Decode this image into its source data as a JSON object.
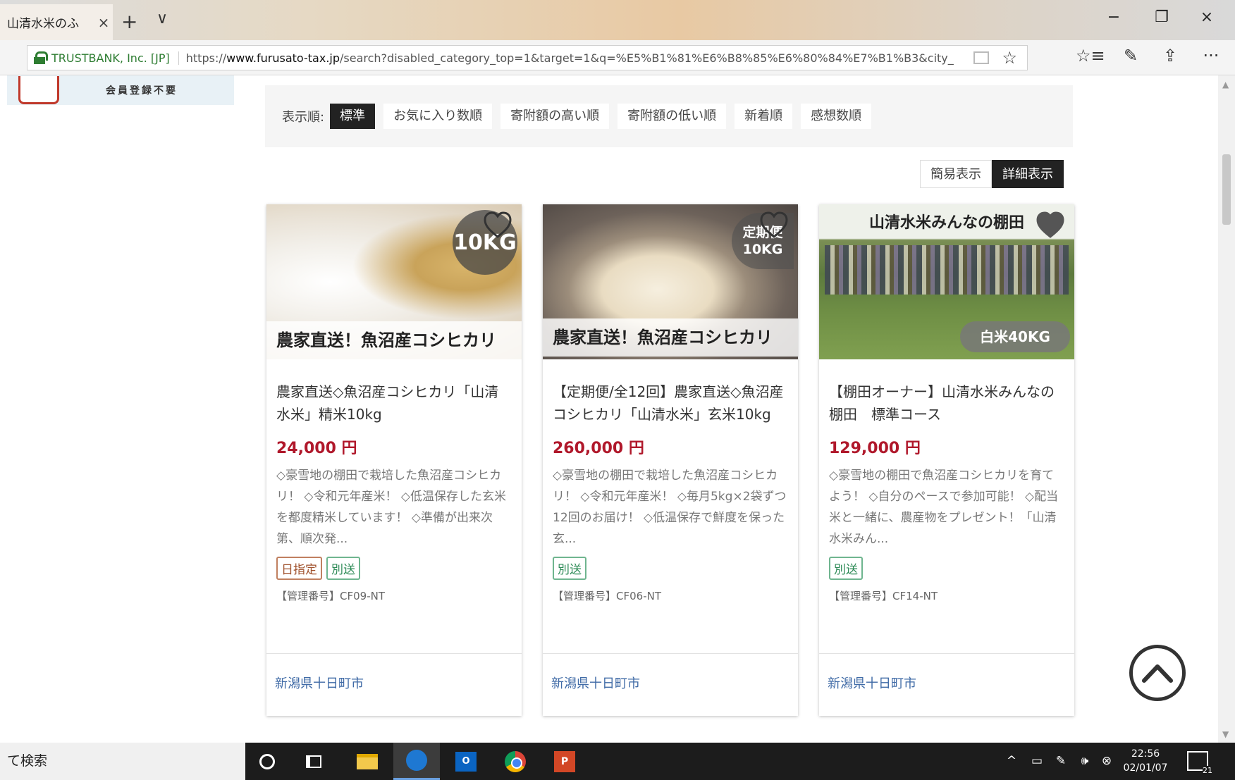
{
  "browser": {
    "tab_title": "山清水米のふ",
    "tab_close": "×",
    "new_tab": "+",
    "tab_dropdown": "∨",
    "minimize": "−",
    "restore": "❐",
    "close": "×",
    "cert_name": "TRUSTBANK, Inc. [JP]",
    "url_prefix": "https://",
    "url_domain": "www.furusato-tax.jp",
    "url_rest": "/search?disabled_category_top=1&target=1&q=%E5%B1%81%E6%B8%85%E6%80%84%E7%B1%B3&city_",
    "favorites_icon": "☆",
    "hub_icon": "☆≡",
    "notes_icon": "✎",
    "share_icon": "⇪",
    "more_icon": "···"
  },
  "banner": {
    "text": "会員登録不要"
  },
  "sort": {
    "label": "表示順:",
    "options": [
      "標準",
      "お気に入り数順",
      "寄附額の高い順",
      "寄附額の低い順",
      "新着順",
      "感想数順"
    ]
  },
  "view": {
    "simple": "簡易表示",
    "detail": "詳細表示"
  },
  "cards": [
    {
      "image_caption": "農家直送！魚沼産コシヒカリ",
      "badge": "10KG",
      "title": "農家直送◇魚沼産コシヒカリ「山清水米」精米10kg",
      "price": "24,000 円",
      "description": "◇豪雪地の棚田で栽培した魚沼産コシヒカリ！ ◇令和元年産米！ ◇低温保存した玄米を都度精米しています！ ◇準備が出来次第、順次発...",
      "tags": [
        "日指定",
        "別送"
      ],
      "mgmt": "【管理番号】CF09-NT",
      "city": "新潟県十日町市"
    },
    {
      "image_caption": "農家直送！魚沼産コシヒカリ",
      "badge_line1": "定期便",
      "badge_line2": "10KG",
      "title": "【定期便/全12回】農家直送◇魚沼産コシヒカリ「山清水米」玄米10kg",
      "price": "260,000 円",
      "description": "◇豪雪地の棚田で栽培した魚沼産コシヒカリ！ ◇令和元年産米！ ◇毎月5kg×2袋ずつ12回のお届け！ ◇低温保存で鮮度を保った玄...",
      "tags": [
        "別送"
      ],
      "mgmt": "【管理番号】CF06-NT",
      "city": "新潟県十日町市"
    },
    {
      "image_caption": "山清水米みんなの棚田",
      "badge": "白米40KG",
      "title": "【棚田オーナー】山清水米みんなの棚田　標準コース",
      "price": "129,000 円",
      "description": "◇豪雪地の棚田で魚沼産コシヒカリを育てよう！ ◇自分のペースで参加可能！ ◇配当米と一緒に、農産物をプレゼント！「山清水米みん...",
      "tags": [
        "別送"
      ],
      "mgmt": "【管理番号】CF14-NT",
      "city": "新潟県十日町市"
    }
  ],
  "taskbar": {
    "search_text": "て検索",
    "outlook_label": "O",
    "ppt_label": "P",
    "tray_up": "^",
    "tray_volume": "🕪",
    "time": "22:56",
    "date": "02/01/07",
    "notif_count": "21"
  }
}
